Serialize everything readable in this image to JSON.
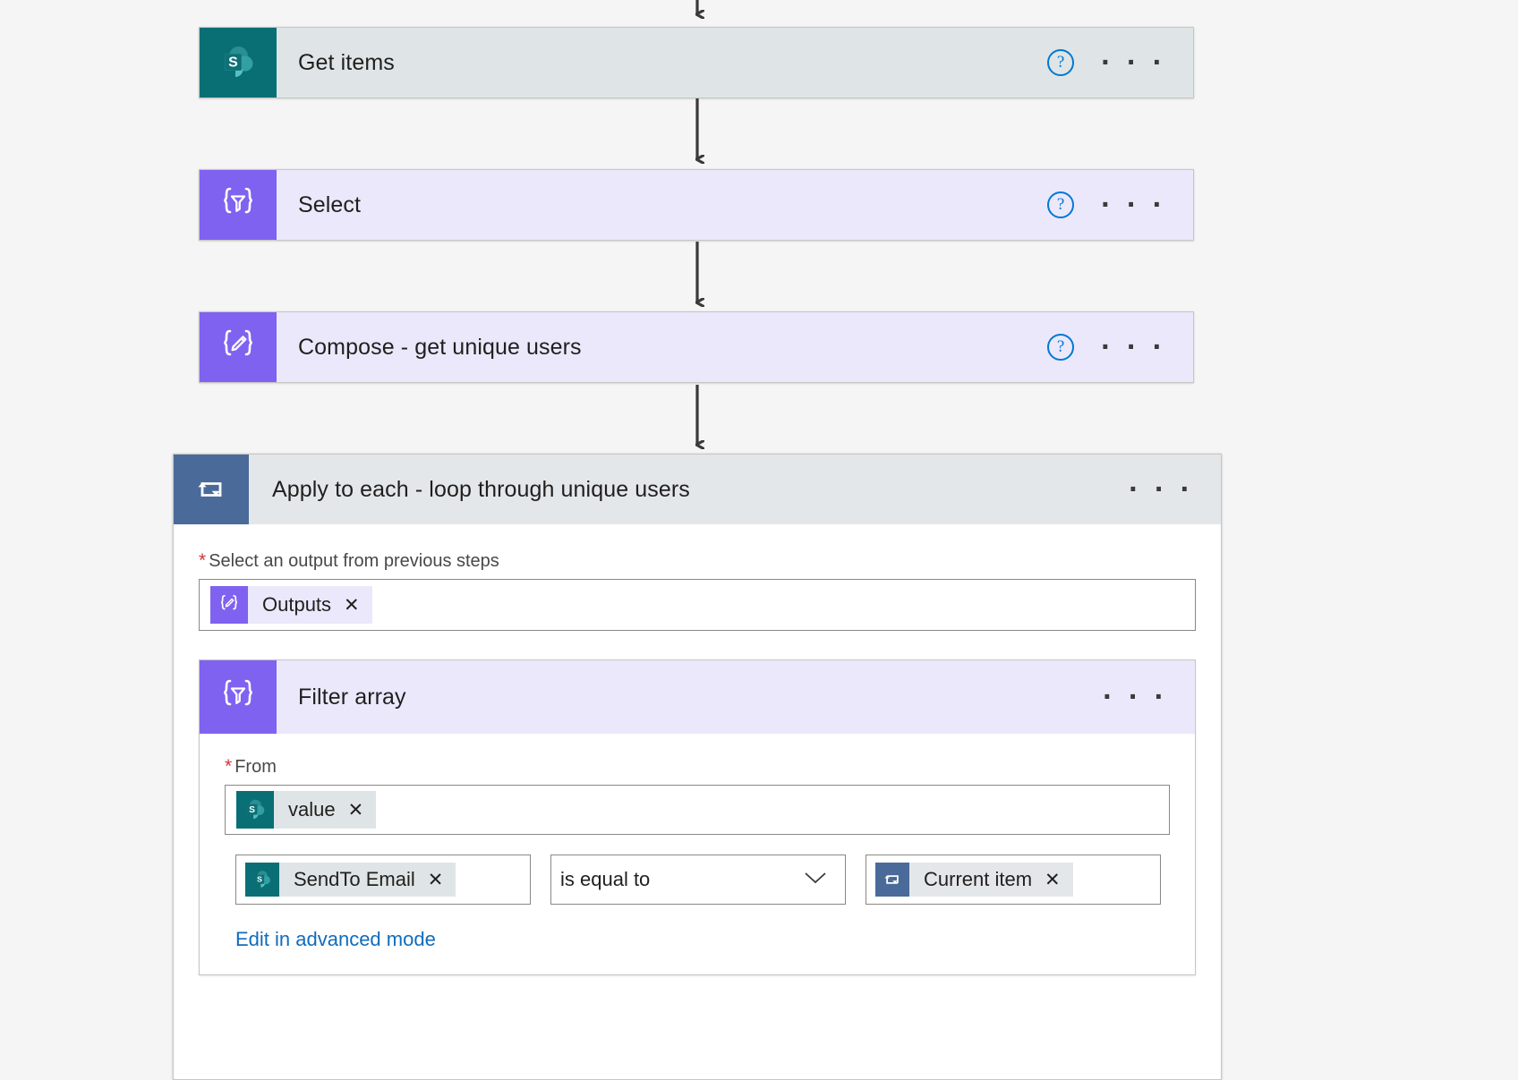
{
  "app": {
    "name": "Power Automate flow designer",
    "canvas_background": "#f5f5f5"
  },
  "colors": {
    "sharepoint_teal": "#0a6f75",
    "data_operation_purple": "#8062f0",
    "loop_slate_blue": "#4a6b99",
    "node_body_gray": "#dfe5e6",
    "node_body_lavender": "#ebe8fb",
    "loop_body_gray": "#e4e7ea",
    "link_blue": "#0f6cbd",
    "help_blue": "#0078d4",
    "required_red": "#d13438",
    "border_gray": "#8a8886"
  },
  "nodes": [
    {
      "id": "get-items",
      "title": "Get items",
      "icon": "sharepoint-icon",
      "icon_bg": "#0a6f75",
      "body_tint": "#dfe5e6",
      "has_help": true,
      "has_menu": true
    },
    {
      "id": "select",
      "title": "Select",
      "icon": "select-braces-funnel-icon",
      "icon_bg": "#8062f0",
      "body_tint": "#ebe8fb",
      "has_help": true,
      "has_menu": true
    },
    {
      "id": "compose",
      "title": "Compose - get unique users",
      "icon": "compose-braces-pencil-icon",
      "icon_bg": "#8062f0",
      "body_tint": "#ebe8fb",
      "has_help": true,
      "has_menu": true
    }
  ],
  "scope": {
    "title": "Apply to each - loop through unique users",
    "icon": "loop-repeat-icon",
    "icon_bg": "#4a6b99",
    "body_tint": "#e4e7ea",
    "has_menu": true,
    "input_field": {
      "label": "Select an output from previous steps",
      "required": true,
      "required_marker": "*",
      "token": {
        "text": "Outputs",
        "icon": "compose-braces-pencil-icon",
        "icon_bg": "#8062f0",
        "chip_tint": "#ebe8fb",
        "remove_label": "✕"
      }
    },
    "nested_action": {
      "title": "Filter array",
      "icon": "filter-braces-funnel-icon",
      "icon_bg": "#8062f0",
      "body_tint": "#ebe8fb",
      "has_menu": true,
      "from_field": {
        "label": "From",
        "required": true,
        "required_marker": "*",
        "token": {
          "text": "value",
          "icon": "sharepoint-icon",
          "icon_bg": "#0a6f75",
          "chip_tint": "#dfe5e6",
          "remove_label": "✕"
        }
      },
      "condition": {
        "left": {
          "text": "SendTo Email",
          "icon": "sharepoint-icon",
          "icon_bg": "#0a6f75",
          "chip_tint": "#dfe5e6",
          "remove_label": "✕"
        },
        "operator": {
          "selected": "is equal to",
          "chevron": "chevron-down-icon",
          "options": [
            "is equal to"
          ]
        },
        "right": {
          "text": "Current item",
          "icon": "loop-repeat-icon",
          "icon_bg": "#4a6b99",
          "chip_tint": "#e4e7ea",
          "remove_label": "✕"
        }
      },
      "advanced_mode_link": "Edit in advanced mode"
    }
  },
  "menu_glyph": "· · ·",
  "help_glyph": "?"
}
